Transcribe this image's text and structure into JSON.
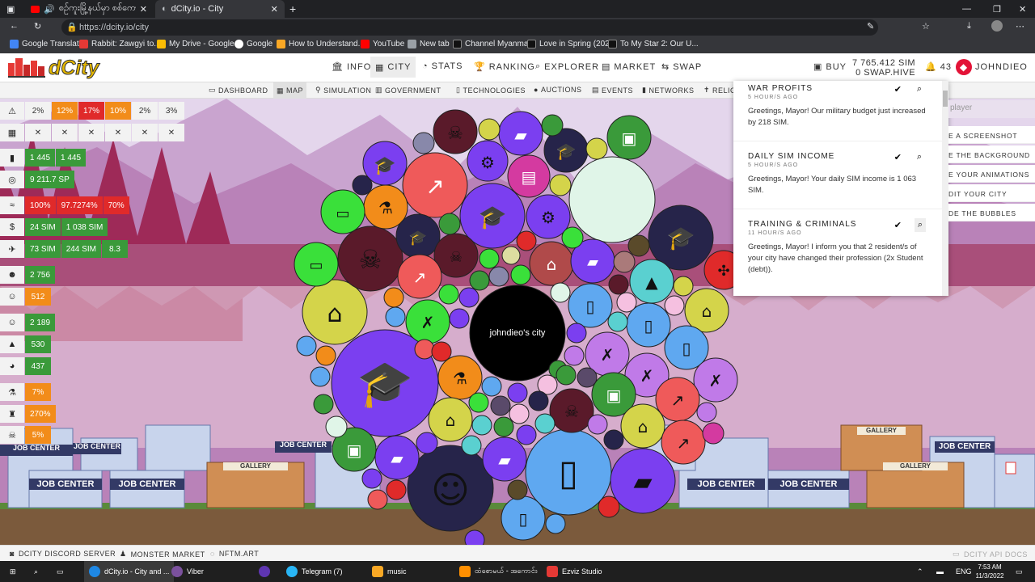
{
  "browser": {
    "tabs": [
      {
        "title": "စဥ်ကူးမြို့နယ်မှာ စစ်ကောင်စီ",
        "active": false
      },
      {
        "title": "dCity.io - City",
        "active": true
      }
    ],
    "url": "https://dcity.io/city",
    "bookmarks": [
      "Google Translate",
      "Rabbit: Zawgyi to...",
      "My Drive - Google...",
      "Google",
      "How to Understand...",
      "YouTube",
      "New tab",
      "Channel Myanmar",
      "Love in Spring (202...",
      "To My Star 2: Our U..."
    ]
  },
  "nav": {
    "logo": "dCity",
    "items": [
      "INFO",
      "CITY",
      "STATS",
      "RANKING",
      "EXPLORER",
      "MARKET",
      "SWAP"
    ],
    "buy": "BUY",
    "sim": "7 765.412 SIM",
    "swap_hive": "0 SWAP.HIVE",
    "bell_count": "43",
    "user": "JOHNDIEO"
  },
  "subnav": [
    "DASHBOARD",
    "MAP",
    "SIMULATION",
    "GOVERNMENT",
    "TECHNOLOGIES",
    "AUCTIONS",
    "EVENTS",
    "NETWORKS",
    "RELIG"
  ],
  "stats": [
    {
      "icon": "warning-icon",
      "cells": [
        {
          "v": "2%",
          "c": "w"
        },
        {
          "v": "12%",
          "c": "o"
        },
        {
          "v": "17%",
          "c": "r"
        },
        {
          "v": "10%",
          "c": "o"
        },
        {
          "v": "2%",
          "c": "w"
        },
        {
          "v": "3%",
          "c": "w"
        }
      ]
    },
    {
      "icon": "calendar-icon",
      "cells": [
        {
          "v": "✕",
          "c": "w"
        },
        {
          "v": "✕",
          "c": "w"
        },
        {
          "v": "✕",
          "c": "w"
        },
        {
          "v": "✕",
          "c": "w"
        },
        {
          "v": "✕",
          "c": "w"
        },
        {
          "v": "✕",
          "c": "w"
        }
      ]
    },
    {
      "icon": "building-icon",
      "cells": [
        {
          "v": "1 445",
          "c": "g"
        },
        {
          "v": "1 445",
          "c": "g"
        }
      ]
    },
    {
      "icon": "coins-icon",
      "cells": [
        {
          "v": "9 211.7 SP",
          "c": "g"
        }
      ]
    },
    {
      "icon": "water-icon",
      "cells": [
        {
          "v": "100%",
          "c": "r"
        },
        {
          "v": "97.7274%",
          "c": "r"
        },
        {
          "v": "70%",
          "c": "r"
        }
      ]
    },
    {
      "icon": "dollar-icon",
      "cells": [
        {
          "v": "24 SIM",
          "c": "g"
        },
        {
          "v": "1 038 SIM",
          "c": "g"
        }
      ]
    },
    {
      "icon": "plane-icon",
      "cells": [
        {
          "v": "73 SIM",
          "c": "g"
        },
        {
          "v": "244 SIM",
          "c": "g"
        },
        {
          "v": "8.3",
          "c": "g"
        }
      ]
    },
    {
      "icon": "person-icon",
      "cells": [
        {
          "v": "2 756",
          "c": "g"
        }
      ]
    },
    {
      "icon": "people-icon",
      "cells": [
        {
          "v": "512",
          "c": "o"
        }
      ]
    },
    {
      "icon": "smile-icon",
      "cells": [
        {
          "v": "2 189",
          "c": "g"
        }
      ]
    },
    {
      "icon": "graduation-icon",
      "cells": [
        {
          "v": "530",
          "c": "g"
        }
      ]
    },
    {
      "icon": "palette-icon",
      "cells": [
        {
          "v": "437",
          "c": "g"
        }
      ]
    },
    {
      "icon": "flask-icon",
      "cells": [
        {
          "v": "7%",
          "c": "o"
        }
      ]
    },
    {
      "icon": "thief-icon",
      "cells": [
        {
          "v": "270%",
          "c": "o"
        }
      ]
    },
    {
      "icon": "skull-icon",
      "cells": [
        {
          "v": "5%",
          "c": "o"
        }
      ]
    }
  ],
  "city_name": "johndieo's city",
  "buildings": {
    "job_center": "JOB CENTER",
    "gallery": "GALLERY"
  },
  "notifications": [
    {
      "title": "WAR PROFITS",
      "time": "5 HOUR/S AGO",
      "body": "Greetings, Mayor! Our military budget just increased by 218 SIM."
    },
    {
      "title": "DAILY SIM INCOME",
      "time": "5 HOUR/S AGO",
      "body": "Greetings, Mayor! Your daily SIM income is 1 063 SIM."
    },
    {
      "title": "TRAINING & CRIMINALS",
      "time": "11 HOUR/S AGO",
      "body": "Greetings, Mayor! I inform you that 2 resident/s of your city have changed their profession (2x Student (debt))."
    }
  ],
  "right_menu": {
    "search_placeholder": "player",
    "items": [
      "E A SCREENSHOT",
      "E THE BACKGROUND",
      "E YOUR ANIMATIONS",
      "DIT YOUR CITY",
      "DE THE BUBBLES"
    ]
  },
  "bottom": {
    "discord": "DCITY DISCORD SERVER",
    "monster": "MONSTER MARKET",
    "nftm": "NFTM.ART",
    "api": "DCITY API DOCS"
  },
  "taskbar": {
    "items": [
      "dCity.io - City and ...",
      "Viber",
      "Telegram (7)",
      "music",
      "ထံစောမယ် - အကောင်းဆုံး...",
      "Ezviz Studio"
    ],
    "lang": "ENG",
    "time": "7:53 AM",
    "date": "11/3/2022"
  },
  "colors": {
    "green": "#3a9a3a",
    "orange": "#f28c1a",
    "red": "#e02a2a",
    "accent": "#e6b800"
  }
}
